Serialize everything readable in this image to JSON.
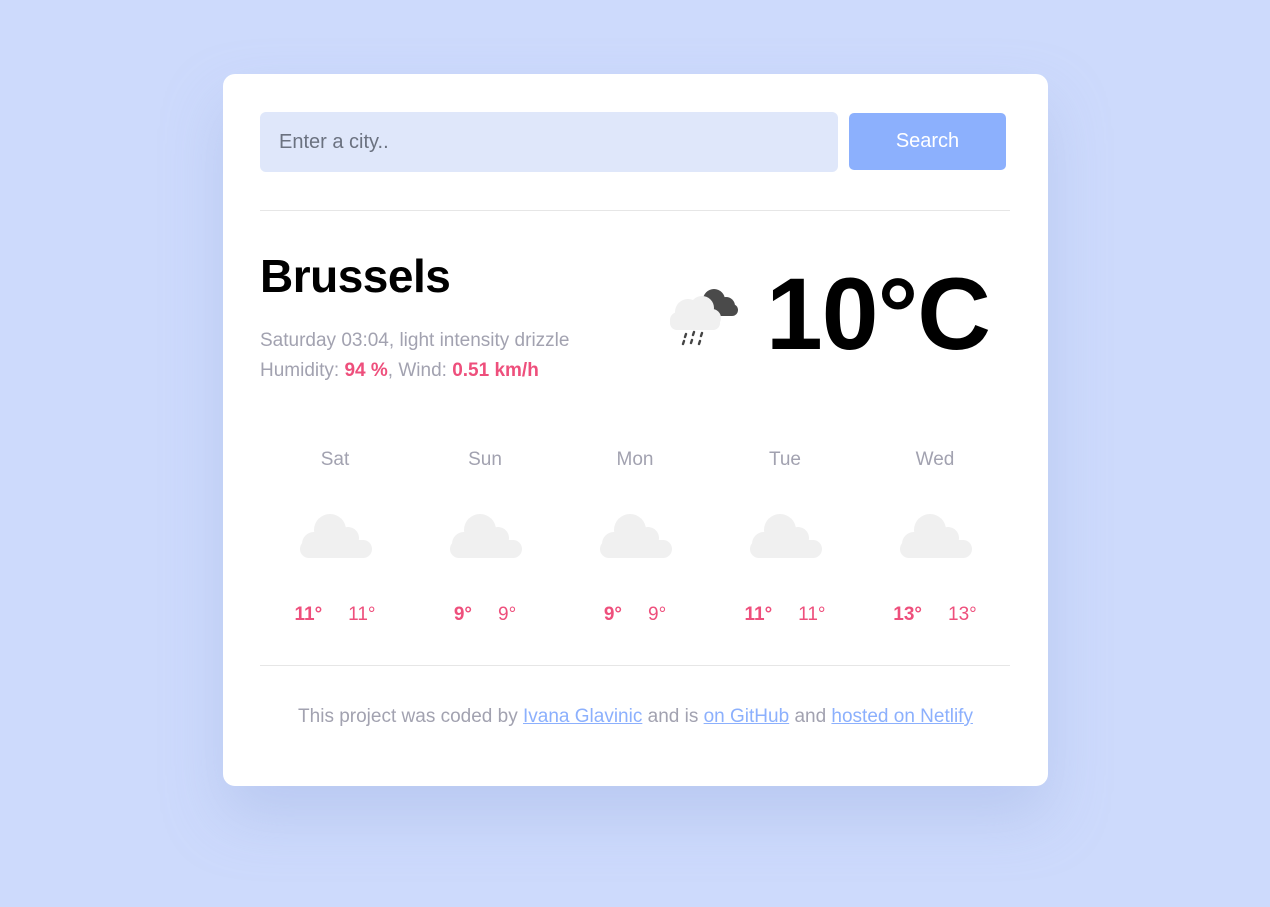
{
  "search": {
    "placeholder": "Enter a city..",
    "value": "",
    "button_label": "Search"
  },
  "current": {
    "city": "Brussels",
    "date_time": "Saturday 03:04",
    "description": "light intensity drizzle",
    "humidity_label": "Humidity:",
    "humidity_value": "94 %",
    "wind_label": "Wind:",
    "wind_value": "0.51 km/h",
    "icon": "cloud-drizzle-icon",
    "temperature": "10",
    "unit": "°C"
  },
  "forecast": [
    {
      "day": "Sat",
      "icon": "cloud-icon",
      "max": "11°",
      "min": "11°"
    },
    {
      "day": "Sun",
      "icon": "cloud-icon",
      "max": "9°",
      "min": "9°"
    },
    {
      "day": "Mon",
      "icon": "cloud-icon",
      "max": "9°",
      "min": "9°"
    },
    {
      "day": "Tue",
      "icon": "cloud-icon",
      "max": "11°",
      "min": "11°"
    },
    {
      "day": "Wed",
      "icon": "cloud-icon",
      "max": "13°",
      "min": "13°"
    }
  ],
  "footer": {
    "text_1": "This project was coded by",
    "author_link": "Ivana Glavinic",
    "text_2": "and is",
    "github_link": "on GitHub",
    "text_3": "and",
    "netlify_link": "hosted on Netlify"
  },
  "colors": {
    "background": "#cddafc",
    "accent": "#8cb0fd",
    "highlight": "#ee4f7c",
    "input_bg": "#dfe7fa",
    "muted_text": "#a2a2b0"
  }
}
